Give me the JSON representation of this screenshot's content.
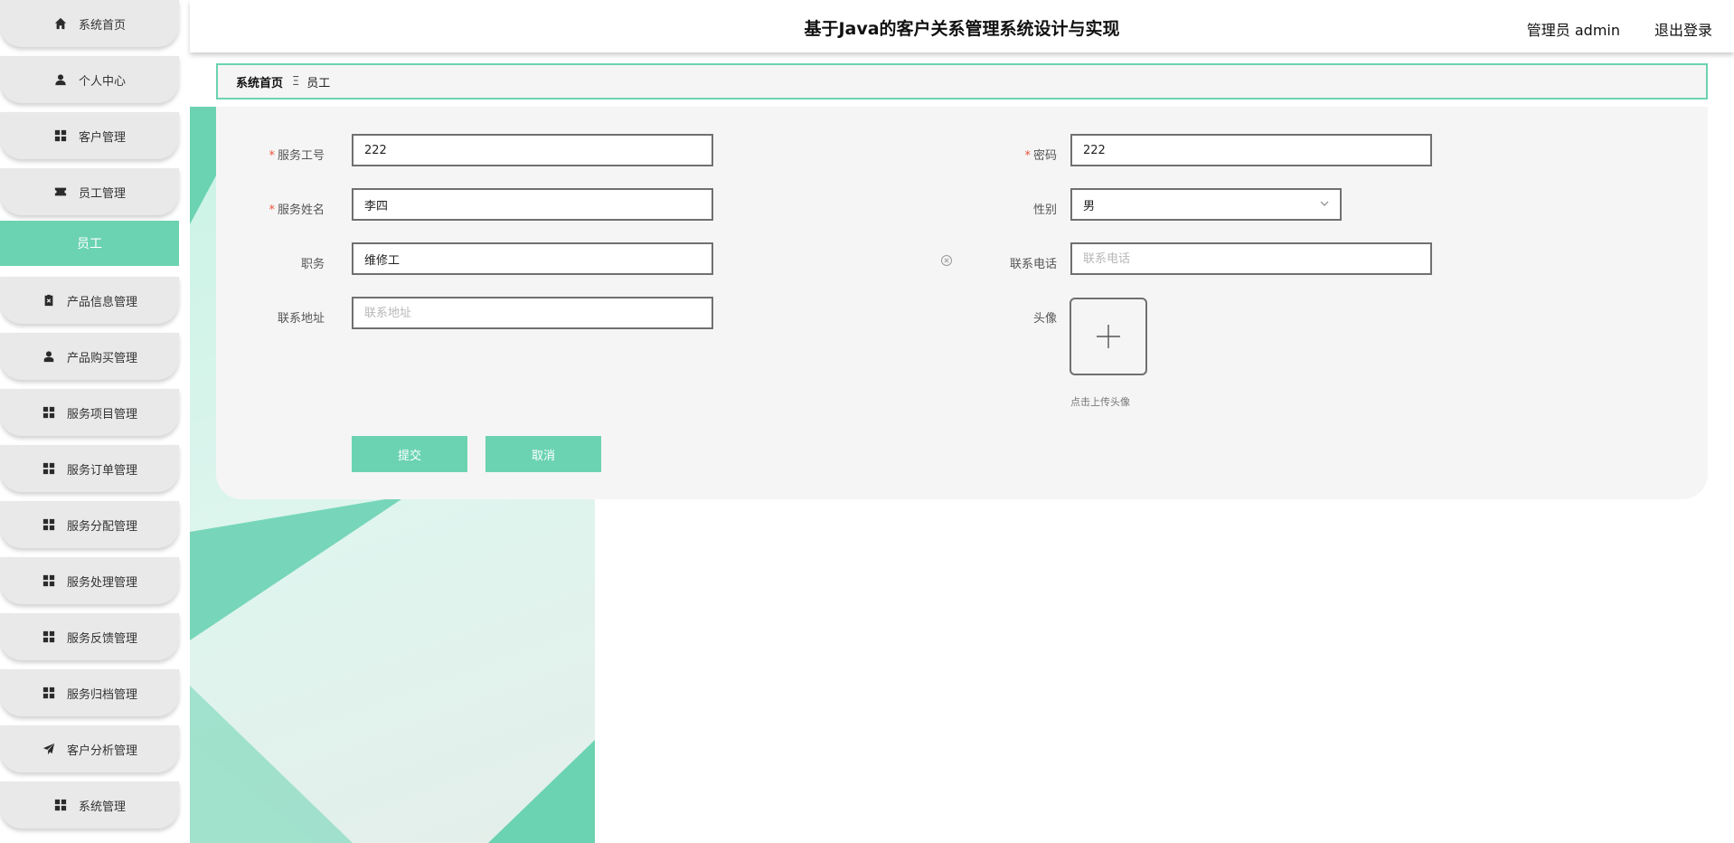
{
  "app": {
    "title": "基于Java的客户关系管理系统设计与实现",
    "user_label": "管理员 admin",
    "logout_label": "退出登录"
  },
  "sidebar": {
    "items": [
      {
        "label": "系统首页",
        "icon": "home-icon"
      },
      {
        "label": "个人中心",
        "icon": "person-icon"
      },
      {
        "label": "客户管理",
        "icon": "grid-icon"
      },
      {
        "label": "员工管理",
        "icon": "ticket-icon"
      },
      {
        "label": "产品信息管理",
        "icon": "clipboard-icon"
      },
      {
        "label": "产品购买管理",
        "icon": "user-icon"
      },
      {
        "label": "服务项目管理",
        "icon": "grid-icon"
      },
      {
        "label": "服务订单管理",
        "icon": "grid-icon"
      },
      {
        "label": "服务分配管理",
        "icon": "grid-icon"
      },
      {
        "label": "服务处理管理",
        "icon": "grid-icon"
      },
      {
        "label": "服务反馈管理",
        "icon": "grid-icon"
      },
      {
        "label": "服务归档管理",
        "icon": "grid-icon"
      },
      {
        "label": "客户分析管理",
        "icon": "send-icon"
      },
      {
        "label": "系统管理",
        "icon": "grid-icon"
      }
    ],
    "active_sub": "员工"
  },
  "breadcrumb": {
    "home": "系统首页",
    "separator": "Ξ",
    "current": "员工"
  },
  "form": {
    "service_id": {
      "label": "服务工号",
      "value": "222",
      "required": true
    },
    "password": {
      "label": "密码",
      "value": "222",
      "required": true
    },
    "service_name": {
      "label": "服务姓名",
      "value": "李四",
      "required": true
    },
    "gender": {
      "label": "性别",
      "value": "男"
    },
    "position": {
      "label": "职务",
      "value": "维修工"
    },
    "phone": {
      "label": "联系电话",
      "value": "",
      "placeholder": "联系电话"
    },
    "address": {
      "label": "联系地址",
      "value": "",
      "placeholder": "联系地址"
    },
    "avatar": {
      "label": "头像",
      "hint": "点击上传头像"
    },
    "submit_label": "提交",
    "cancel_label": "取消"
  },
  "colors": {
    "accent": "#6bd3b2",
    "required": "#e8543d",
    "sidebar_item_bg": "#e9e9e9",
    "panel_bg": "#f6f5f5"
  }
}
